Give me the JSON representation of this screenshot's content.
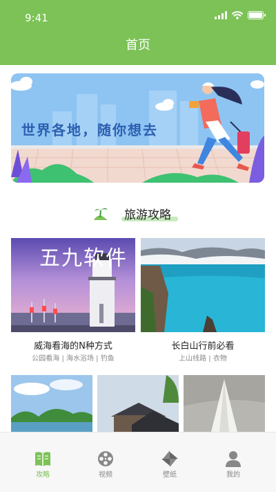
{
  "status_bar": {
    "time": "9:41",
    "signal_icon": "cellular-signal-icon",
    "wifi_icon": "wifi-icon",
    "battery_icon": "battery-icon"
  },
  "header": {
    "title": "首页"
  },
  "banner": {
    "text": "世界各地，随你想去"
  },
  "section": {
    "title": "旅游攻略",
    "icon": "palm-island-icon"
  },
  "cards": [
    {
      "title": "威海看海的N种方式",
      "tags": "公园看海 | 海水浴场 | 钓鱼",
      "watermark": "五九软件"
    },
    {
      "title": "长白山行前必看",
      "tags": "上山线路 | 衣物"
    }
  ],
  "tabs": [
    {
      "label": "攻略",
      "icon": "book-icon",
      "active": true
    },
    {
      "label": "视频",
      "icon": "film-reel-icon",
      "active": false
    },
    {
      "label": "壁纸",
      "icon": "pinwheel-icon",
      "active": false
    },
    {
      "label": "我的",
      "icon": "person-icon",
      "active": false
    }
  ],
  "colors": {
    "brand": "#7cc257",
    "active_tab": "#7cc257",
    "inactive_tab": "#888888",
    "banner_text": "#2b5fb0"
  }
}
